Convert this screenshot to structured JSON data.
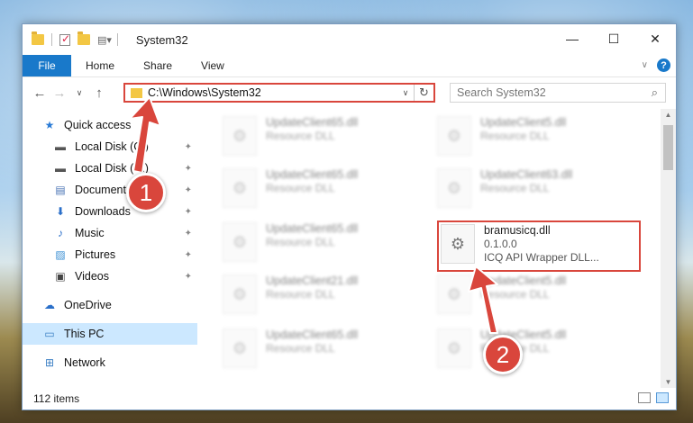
{
  "window": {
    "title": "System32",
    "controls": {
      "minimize": "—",
      "maximize": "☐",
      "close": "✕"
    }
  },
  "ribbon": {
    "tabs": [
      "File",
      "Home",
      "Share",
      "View"
    ],
    "help": "?"
  },
  "address": {
    "path": "C:\\Windows\\System32",
    "search_placeholder": "Search System32"
  },
  "sidebar": {
    "items": [
      {
        "label": "Quick access",
        "icon": "star-icon"
      },
      {
        "label": "Local Disk (C:)",
        "icon": "drive-icon",
        "pinned": true
      },
      {
        "label": "Local Disk (D:)",
        "icon": "drive-icon",
        "pinned": true
      },
      {
        "label": "Documents",
        "icon": "documents-icon",
        "pinned": true
      },
      {
        "label": "Downloads",
        "icon": "download-icon",
        "pinned": true
      },
      {
        "label": "Music",
        "icon": "music-icon",
        "pinned": true
      },
      {
        "label": "Pictures",
        "icon": "pictures-icon",
        "pinned": true
      },
      {
        "label": "Videos",
        "icon": "videos-icon",
        "pinned": true
      },
      {
        "label": "OneDrive",
        "icon": "cloud-icon"
      },
      {
        "label": "This PC",
        "icon": "computer-icon"
      },
      {
        "label": "Network",
        "icon": "network-icon"
      }
    ]
  },
  "files": [
    {
      "name": "UpdateClient65.dll",
      "desc": "Resource DLL"
    },
    {
      "name": "UpdateClient5.dll",
      "desc": "Resource DLL"
    },
    {
      "name": "UpdateClient65.dll",
      "desc": "Resource DLL"
    },
    {
      "name": "UpdateClient63.dll",
      "desc": "Resource DLL"
    },
    {
      "name": "UpdateClient65.dll",
      "desc": "Resource DLL"
    },
    {
      "name": "bramusicq.dll",
      "version": "0.1.0.0",
      "desc": "ICQ API Wrapper DLL..."
    },
    {
      "name": "UpdateClient21.dll",
      "desc": "Resource DLL"
    },
    {
      "name": "UpdateClient5.dll",
      "desc": "Resource DLL"
    },
    {
      "name": "UpdateClient65.dll",
      "desc": "Resource DLL"
    },
    {
      "name": "UpdateClient5.dll",
      "desc": "Resource DLL"
    }
  ],
  "status": {
    "items": "112 items"
  },
  "annotations": {
    "step1": "1",
    "step2": "2"
  }
}
